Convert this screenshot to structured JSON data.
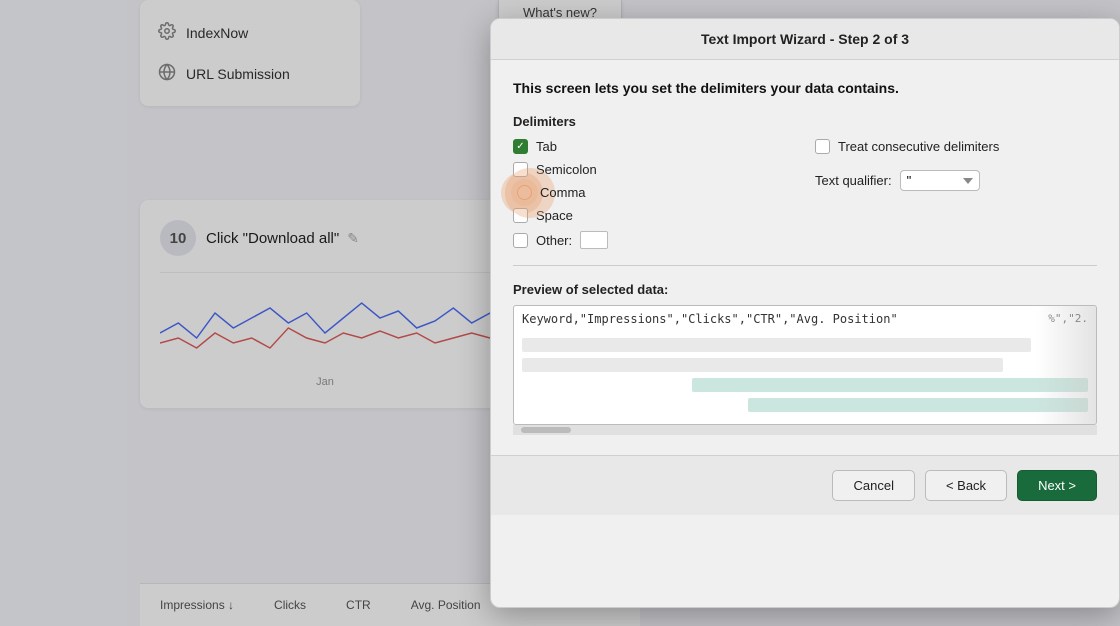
{
  "whats_new_tab": "What's new?",
  "modal": {
    "title": "Text Import Wizard - Step 2 of 3",
    "description": "This screen lets you set the delimiters your data contains.",
    "delimiters_label": "Delimiters",
    "delimiters": [
      {
        "id": "tab",
        "label": "Tab",
        "type": "checkbox",
        "checked": true
      },
      {
        "id": "semicolon",
        "label": "Semicolon",
        "type": "checkbox",
        "checked": false
      },
      {
        "id": "comma",
        "label": "Comma",
        "type": "radio",
        "checked": false,
        "highlighted": true
      },
      {
        "id": "space",
        "label": "Space",
        "type": "checkbox",
        "checked": false
      },
      {
        "id": "other",
        "label": "Other:",
        "type": "checkbox",
        "checked": false
      }
    ],
    "treat_consecutive": "Treat consecutive delimiters",
    "text_qualifier_label": "Text qualifier:",
    "text_qualifier_value": "\"",
    "preview_label": "Preview of selected data:",
    "preview_first_row": "Keyword,\"Impressions\",\"Clicks\",\"CTR\",\"Avg. Position\"",
    "preview_overflow_text": "%\",\"2.",
    "buttons": {
      "cancel": "Cancel",
      "back": "< Back",
      "next": "Next >"
    }
  },
  "sidebar": {
    "items": [
      {
        "label": "IndexNow",
        "icon": "gear-icon"
      },
      {
        "label": "URL Submission",
        "icon": "globe-icon"
      }
    ]
  },
  "step": {
    "number": "10",
    "title": "Click \"Download all\"",
    "x_label": "Jan"
  },
  "table_headers": {
    "impressions": "Impressions",
    "clicks": "Clicks",
    "ctr": "CTR",
    "avg_position": "Avg. Position"
  }
}
